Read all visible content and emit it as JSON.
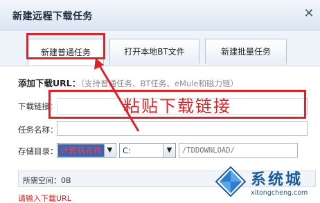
{
  "window": {
    "title": "新建远程下载任务"
  },
  "tabs": [
    {
      "label": "新建普通任务",
      "active": true
    },
    {
      "label": "打开本地BT文件",
      "active": false
    },
    {
      "label": "新建批量任务",
      "active": false
    }
  ],
  "section": {
    "title": "添加下载URL：",
    "hint": "（支持普通任务、BT任务、eMule和磁力链）"
  },
  "form": {
    "url_label": "下载链接：",
    "url_value": "",
    "name_label": "任务名称：",
    "name_value": "",
    "dir_label": "存储目录：",
    "computer_select": "计算机名称",
    "drive_select": "C:",
    "path_value": "/TDDOWNLOAD/",
    "space_label": "所需空间：0B",
    "error": "请输入下载URL"
  },
  "annotation": {
    "paste_text": "粘贴下载链接",
    "color": "#d7262b"
  },
  "watermark": {
    "brand": "系统城",
    "url": "xitongcheng.com",
    "color": "#1a5a9e"
  }
}
